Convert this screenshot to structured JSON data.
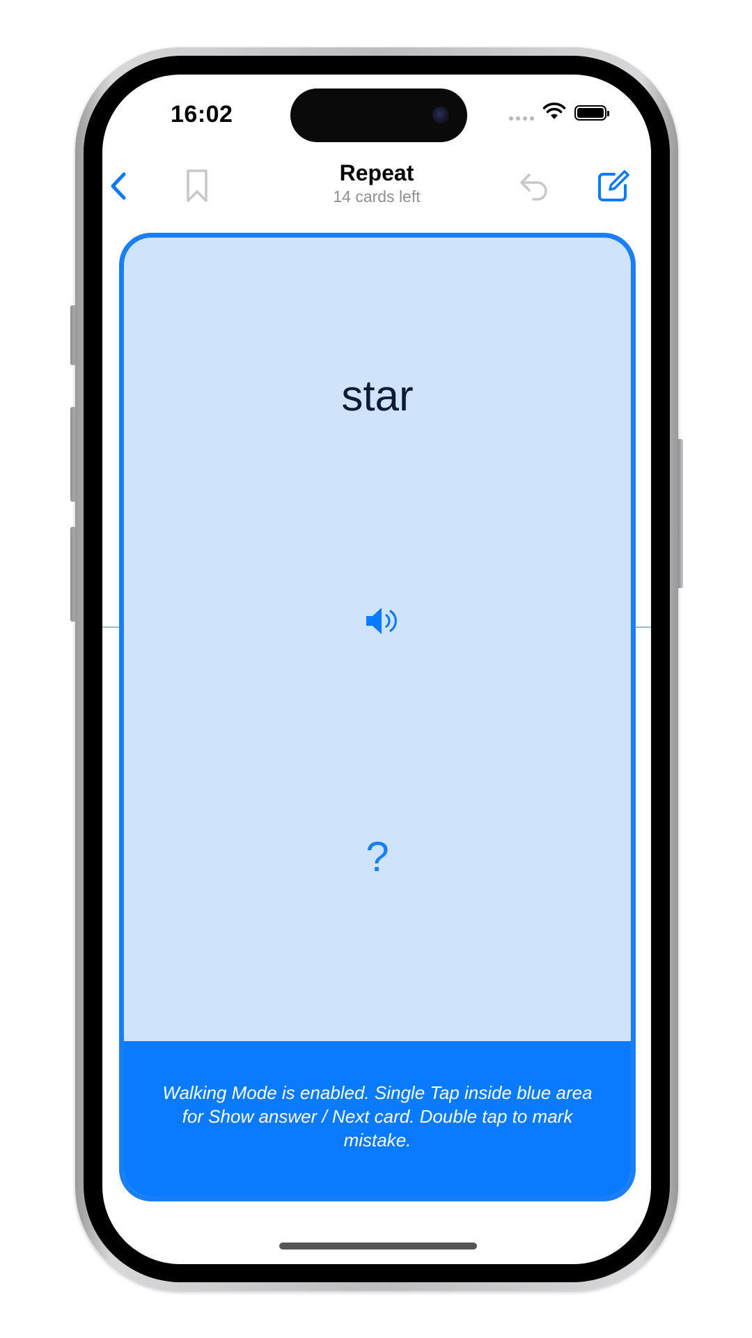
{
  "status_bar": {
    "time": "16:02",
    "icons": [
      "cellular-dots-icon",
      "wifi-icon",
      "battery-icon"
    ]
  },
  "nav": {
    "title": "Repeat",
    "subtitle": "14 cards left",
    "left_icons": [
      "back-chevron-icon",
      "bookmark-icon"
    ],
    "right_icons": [
      "undo-icon",
      "edit-icon"
    ]
  },
  "card": {
    "word": "star",
    "answer_placeholder": "?",
    "speaker_icon": "speaker-icon",
    "walking_mode_message": "Walking Mode is enabled. Single Tap inside blue area for Show answer / Next card. Double tap to mark mistake."
  },
  "colors": {
    "accent": "#0a7afe",
    "card_background": "#cfe3fb",
    "card_border": "#1a7ff5",
    "muted_icon": "#c7c7cc",
    "subtitle_gray": "#8e8e93"
  }
}
